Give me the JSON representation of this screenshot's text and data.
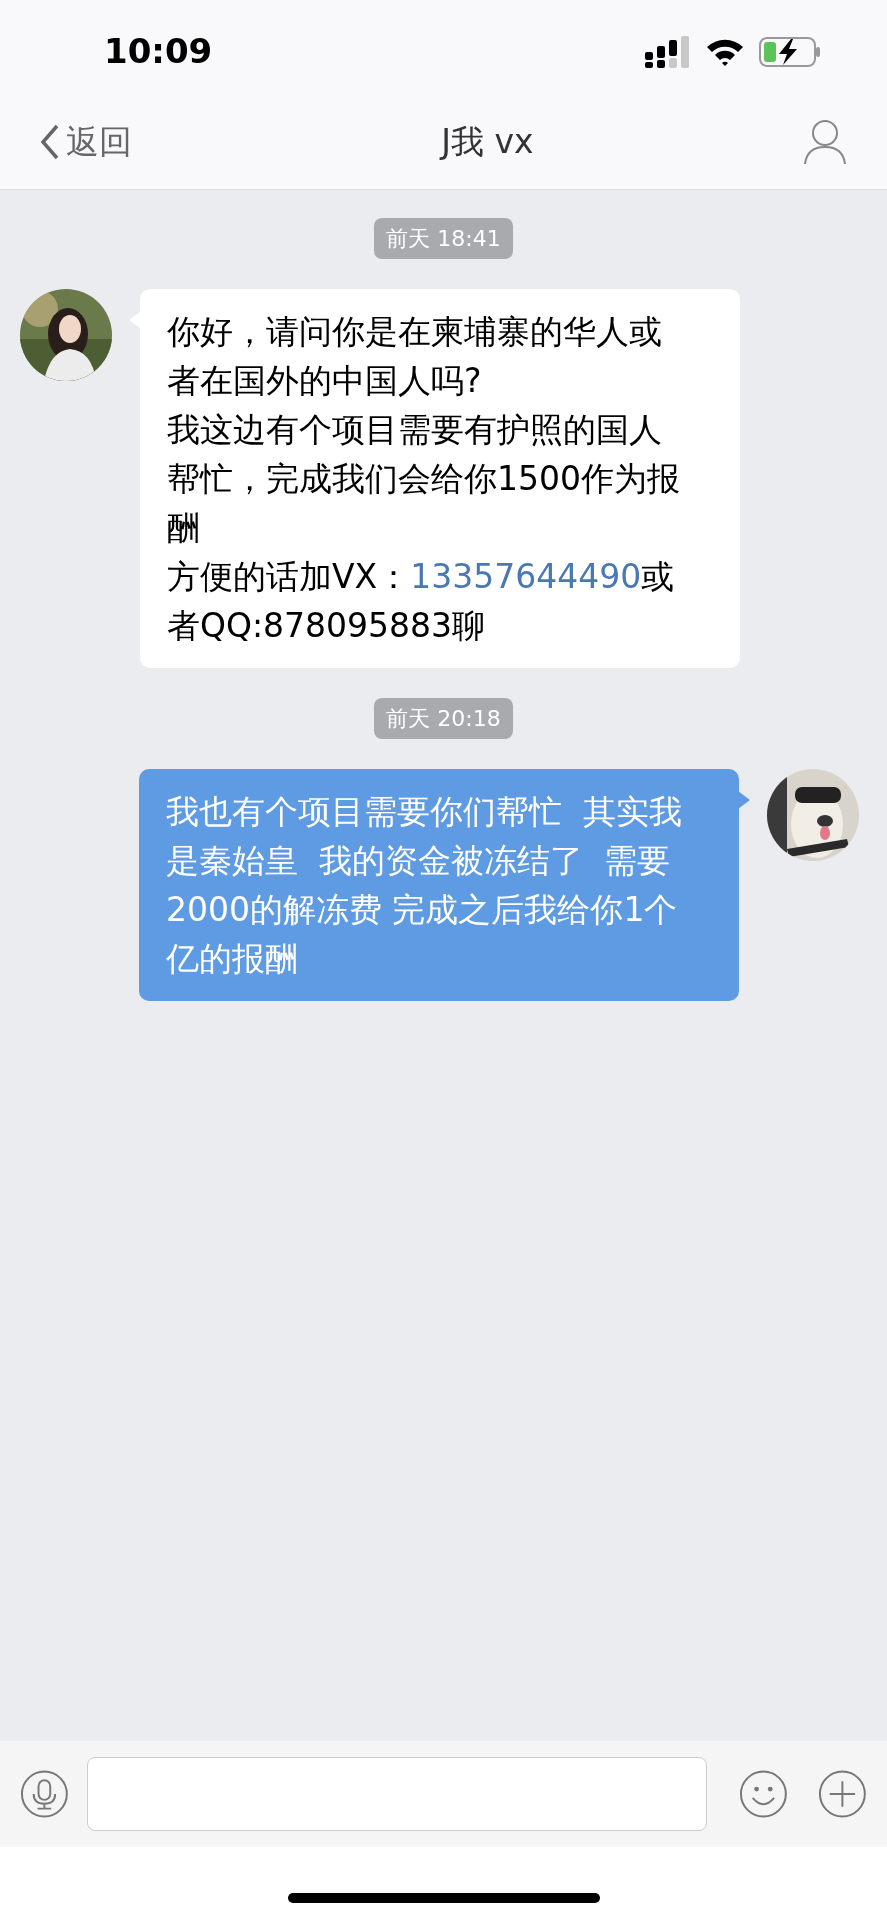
{
  "status_bar": {
    "time": "10:09"
  },
  "nav": {
    "back": "返回",
    "title": "J我 vx"
  },
  "messages": [
    {
      "kind": "time",
      "text": "前天 18:41"
    },
    {
      "kind": "incoming",
      "paragraphs": [
        [
          {
            "kind": "text",
            "text": "你好，请问你是在柬埔寨的华人或者在国外的中国人吗?"
          }
        ],
        [
          {
            "kind": "text",
            "text": "我这边有个项目需要有护照的国人帮忙，完成我们会给你1500作为报酬"
          }
        ],
        [
          {
            "kind": "text",
            "text": "方便的话加VX："
          },
          {
            "kind": "link",
            "text": "13357644490"
          },
          {
            "kind": "text",
            "text": "或者QQ:878095883聊"
          }
        ]
      ]
    },
    {
      "kind": "time",
      "text": "前天 20:18"
    },
    {
      "kind": "outgoing",
      "paragraphs": [
        [
          {
            "kind": "text",
            "text": "我也有个项目需要你们帮忙  其实我是秦始皇  我的资金被冻结了  需要2000的解冻费 完成之后我给你1个亿的报酬"
          }
        ]
      ]
    }
  ]
}
